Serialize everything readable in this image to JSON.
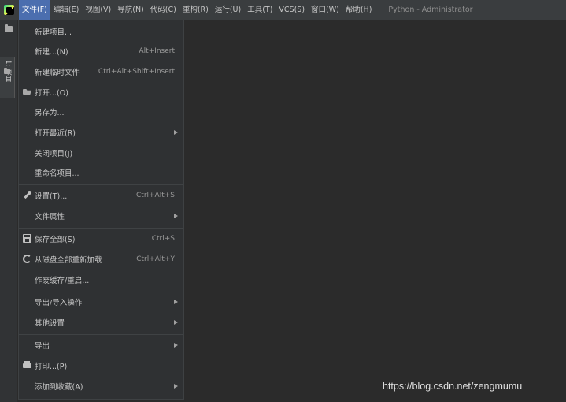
{
  "menubar": {
    "items": [
      "文件(F)",
      "编辑(E)",
      "视图(V)",
      "导航(N)",
      "代码(C)",
      "重构(R)",
      "运行(U)",
      "工具(T)",
      "VCS(S)",
      "窗口(W)",
      "帮助(H)"
    ],
    "active_index": 0,
    "window_title": "Python - Administrator"
  },
  "left_strip": {
    "project_tab_label": "1: 项目"
  },
  "file_menu": {
    "new_project": "新建项目...",
    "new": "新建...(N)",
    "new_shortcut": "Alt+Insert",
    "new_scratch": "新建临时文件",
    "new_scratch_shortcut": "Ctrl+Alt+Shift+Insert",
    "open": "打开...(O)",
    "save_as": "另存为...",
    "open_recent": "打开最近(R)",
    "close_project": "关闭项目(J)",
    "rename_project": "重命名项目...",
    "settings": "设置(T)...",
    "settings_shortcut": "Ctrl+Alt+S",
    "file_properties": "文件属性",
    "save_all": "保存全部(S)",
    "save_all_shortcut": "Ctrl+S",
    "reload_all": "从磁盘全部重新加载",
    "reload_all_shortcut": "Ctrl+Alt+Y",
    "invalidate_caches": "作废缓存/重启...",
    "import_export": "导出/导入操作",
    "other_settings": "其他设置",
    "export": "导出",
    "print": "打印...(P)",
    "add_to_favorites": "添加到收藏(A)"
  },
  "icons": {
    "logo": "pycharm-logo-icon",
    "folder": "folder-icon",
    "open": "open-folder-icon",
    "settings": "wrench-icon",
    "save": "save-icon",
    "reload": "reload-icon",
    "print": "printer-icon"
  },
  "watermark": "https://blog.csdn.net/zengmumu"
}
